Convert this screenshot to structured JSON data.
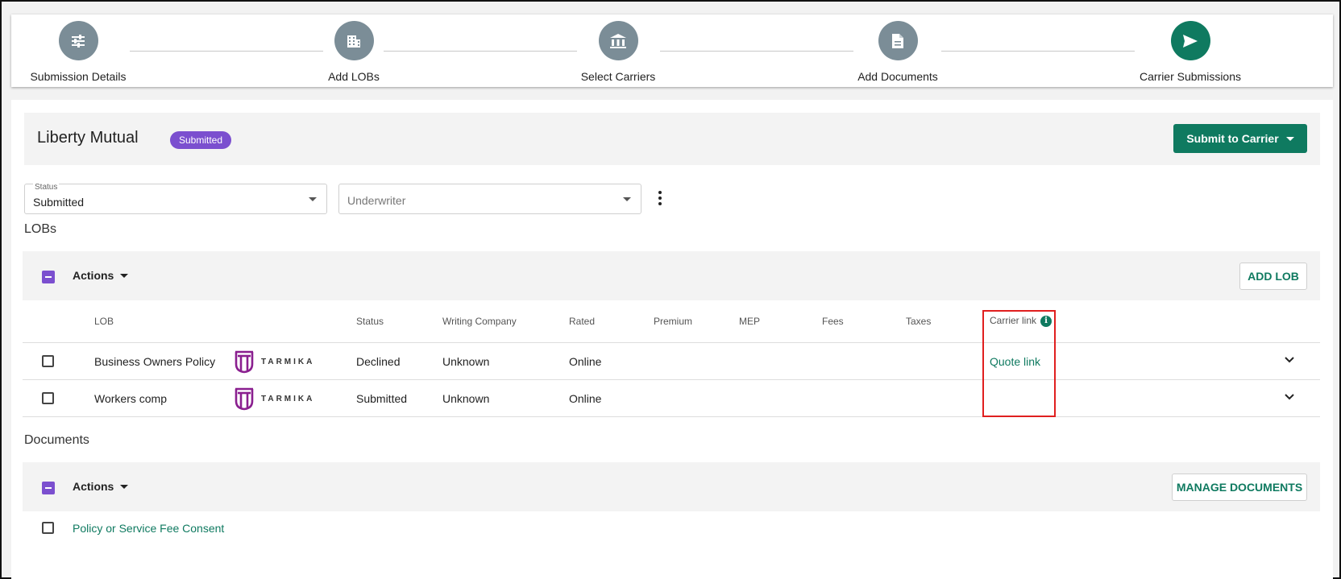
{
  "stepper": {
    "steps": [
      {
        "label": "Submission Details",
        "icon": "sliders-icon"
      },
      {
        "label": "Add LOBs",
        "icon": "building-icon"
      },
      {
        "label": "Select Carriers",
        "icon": "bank-icon"
      },
      {
        "label": "Add Documents",
        "icon": "document-icon"
      },
      {
        "label": "Carrier Submissions",
        "icon": "send-icon",
        "active": true
      }
    ]
  },
  "carrier": {
    "name": "Liberty Mutual",
    "badge": "Submitted",
    "submit_button": "Submit to Carrier"
  },
  "filters": {
    "status_label": "Status",
    "status_value": "Submitted",
    "underwriter_placeholder": "Underwriter"
  },
  "lobs": {
    "section_title": "LOBs",
    "actions_label": "Actions",
    "add_button": "ADD LOB",
    "columns": [
      "LOB",
      "Status",
      "Writing Company",
      "Rated",
      "Premium",
      "MEP",
      "Fees",
      "Taxes",
      "Carrier link"
    ],
    "rows": [
      {
        "lob": "Business Owners Policy",
        "logo_text": "TARMIKA",
        "status": "Declined",
        "writing_company": "Unknown",
        "rated": "Online",
        "carrier_link": "Quote link"
      },
      {
        "lob": "Workers comp",
        "logo_text": "TARMIKA",
        "status": "Submitted",
        "writing_company": "Unknown",
        "rated": "Online",
        "carrier_link": ""
      }
    ]
  },
  "documents": {
    "section_title": "Documents",
    "actions_label": "Actions",
    "manage_button": "MANAGE DOCUMENTS",
    "items": [
      "Policy or Service Fee Consent"
    ]
  },
  "colors": {
    "accent": "#0f7a60",
    "step_inactive": "#7b8d97",
    "badge": "#7b4fcf",
    "highlight": "#e01f1f"
  }
}
